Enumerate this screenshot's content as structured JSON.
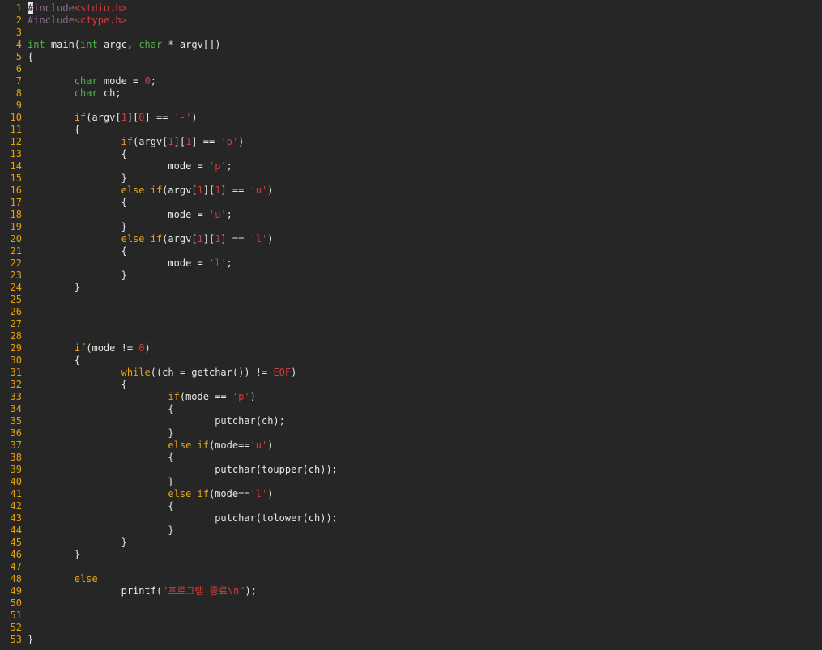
{
  "colors": {
    "background": "#262626",
    "line_number": "#e5a00a",
    "default_text": "#e6e6e6",
    "keyword": "#e8a317",
    "type": "#4fb24a",
    "string_literal": "#d43d3d",
    "preprocessor": "#8c6d8c"
  },
  "editor": {
    "lines": [
      {
        "n": "1",
        "tokens": [
          {
            "t": "#",
            "c": "cursor"
          },
          {
            "t": "include",
            "c": "preproc"
          },
          {
            "t": "<stdio.h>",
            "c": "include"
          }
        ]
      },
      {
        "n": "2",
        "tokens": [
          {
            "t": "#include",
            "c": "preproc"
          },
          {
            "t": "<ctype.h>",
            "c": "include"
          }
        ]
      },
      {
        "n": "3",
        "tokens": []
      },
      {
        "n": "4",
        "tokens": [
          {
            "t": "int",
            "c": "type"
          },
          {
            "t": " main(",
            "c": "default"
          },
          {
            "t": "int",
            "c": "type"
          },
          {
            "t": " argc, ",
            "c": "default"
          },
          {
            "t": "char",
            "c": "type"
          },
          {
            "t": " * argv[])",
            "c": "default"
          }
        ]
      },
      {
        "n": "5",
        "tokens": [
          {
            "t": "{",
            "c": "default"
          }
        ]
      },
      {
        "n": "6",
        "tokens": []
      },
      {
        "n": "7",
        "tokens": [
          {
            "t": "        ",
            "c": "default"
          },
          {
            "t": "char",
            "c": "type"
          },
          {
            "t": " mode = ",
            "c": "default"
          },
          {
            "t": "0",
            "c": "number"
          },
          {
            "t": ";",
            "c": "default"
          }
        ]
      },
      {
        "n": "8",
        "tokens": [
          {
            "t": "        ",
            "c": "default"
          },
          {
            "t": "char",
            "c": "type"
          },
          {
            "t": " ch;",
            "c": "default"
          }
        ]
      },
      {
        "n": "9",
        "tokens": []
      },
      {
        "n": "10",
        "tokens": [
          {
            "t": "        ",
            "c": "default"
          },
          {
            "t": "if",
            "c": "keyword"
          },
          {
            "t": "(argv[",
            "c": "default"
          },
          {
            "t": "1",
            "c": "number"
          },
          {
            "t": "][",
            "c": "default"
          },
          {
            "t": "0",
            "c": "number"
          },
          {
            "t": "] == ",
            "c": "default"
          },
          {
            "t": "'-'",
            "c": "string"
          },
          {
            "t": ")",
            "c": "default"
          }
        ]
      },
      {
        "n": "11",
        "tokens": [
          {
            "t": "        {",
            "c": "default"
          }
        ]
      },
      {
        "n": "12",
        "tokens": [
          {
            "t": "                ",
            "c": "default"
          },
          {
            "t": "if",
            "c": "keyword"
          },
          {
            "t": "(argv[",
            "c": "default"
          },
          {
            "t": "1",
            "c": "number"
          },
          {
            "t": "][",
            "c": "default"
          },
          {
            "t": "1",
            "c": "number"
          },
          {
            "t": "] == ",
            "c": "default"
          },
          {
            "t": "'p'",
            "c": "string"
          },
          {
            "t": ")",
            "c": "default"
          }
        ]
      },
      {
        "n": "13",
        "tokens": [
          {
            "t": "                {",
            "c": "default"
          }
        ]
      },
      {
        "n": "14",
        "tokens": [
          {
            "t": "                        mode = ",
            "c": "default"
          },
          {
            "t": "'p'",
            "c": "string"
          },
          {
            "t": ";",
            "c": "default"
          }
        ]
      },
      {
        "n": "15",
        "tokens": [
          {
            "t": "                }",
            "c": "default"
          }
        ]
      },
      {
        "n": "16",
        "tokens": [
          {
            "t": "                ",
            "c": "default"
          },
          {
            "t": "else if",
            "c": "keyword"
          },
          {
            "t": "(argv[",
            "c": "default"
          },
          {
            "t": "1",
            "c": "number"
          },
          {
            "t": "][",
            "c": "default"
          },
          {
            "t": "1",
            "c": "number"
          },
          {
            "t": "] == ",
            "c": "default"
          },
          {
            "t": "'u'",
            "c": "string"
          },
          {
            "t": ")",
            "c": "default"
          }
        ]
      },
      {
        "n": "17",
        "tokens": [
          {
            "t": "                {",
            "c": "default"
          }
        ]
      },
      {
        "n": "18",
        "tokens": [
          {
            "t": "                        mode = ",
            "c": "default"
          },
          {
            "t": "'u'",
            "c": "string"
          },
          {
            "t": ";",
            "c": "default"
          }
        ]
      },
      {
        "n": "19",
        "tokens": [
          {
            "t": "                }",
            "c": "default"
          }
        ]
      },
      {
        "n": "20",
        "tokens": [
          {
            "t": "                ",
            "c": "default"
          },
          {
            "t": "else if",
            "c": "keyword"
          },
          {
            "t": "(argv[",
            "c": "default"
          },
          {
            "t": "1",
            "c": "number"
          },
          {
            "t": "][",
            "c": "default"
          },
          {
            "t": "1",
            "c": "number"
          },
          {
            "t": "] == ",
            "c": "default"
          },
          {
            "t": "'l'",
            "c": "string"
          },
          {
            "t": ")",
            "c": "default"
          }
        ]
      },
      {
        "n": "21",
        "tokens": [
          {
            "t": "                {",
            "c": "default"
          }
        ]
      },
      {
        "n": "22",
        "tokens": [
          {
            "t": "                        mode = ",
            "c": "default"
          },
          {
            "t": "'l'",
            "c": "string"
          },
          {
            "t": ";",
            "c": "default"
          }
        ]
      },
      {
        "n": "23",
        "tokens": [
          {
            "t": "                }",
            "c": "default"
          }
        ]
      },
      {
        "n": "24",
        "tokens": [
          {
            "t": "        }",
            "c": "default"
          }
        ]
      },
      {
        "n": "25",
        "tokens": []
      },
      {
        "n": "26",
        "tokens": []
      },
      {
        "n": "27",
        "tokens": []
      },
      {
        "n": "28",
        "tokens": []
      },
      {
        "n": "29",
        "tokens": [
          {
            "t": "        ",
            "c": "default"
          },
          {
            "t": "if",
            "c": "keyword"
          },
          {
            "t": "(mode != ",
            "c": "default"
          },
          {
            "t": "0",
            "c": "number"
          },
          {
            "t": ")",
            "c": "default"
          }
        ]
      },
      {
        "n": "30",
        "tokens": [
          {
            "t": "        {",
            "c": "default"
          }
        ]
      },
      {
        "n": "31",
        "tokens": [
          {
            "t": "                ",
            "c": "default"
          },
          {
            "t": "while",
            "c": "keyword"
          },
          {
            "t": "((ch = getchar()) != ",
            "c": "default"
          },
          {
            "t": "EOF",
            "c": "number"
          },
          {
            "t": ")",
            "c": "default"
          }
        ]
      },
      {
        "n": "32",
        "tokens": [
          {
            "t": "                {",
            "c": "default"
          }
        ]
      },
      {
        "n": "33",
        "tokens": [
          {
            "t": "                        ",
            "c": "default"
          },
          {
            "t": "if",
            "c": "keyword"
          },
          {
            "t": "(mode == ",
            "c": "default"
          },
          {
            "t": "'p'",
            "c": "string"
          },
          {
            "t": ")",
            "c": "default"
          }
        ]
      },
      {
        "n": "34",
        "tokens": [
          {
            "t": "                        {",
            "c": "default"
          }
        ]
      },
      {
        "n": "35",
        "tokens": [
          {
            "t": "                                putchar(ch);",
            "c": "default"
          }
        ]
      },
      {
        "n": "36",
        "tokens": [
          {
            "t": "                        }",
            "c": "default"
          }
        ]
      },
      {
        "n": "37",
        "tokens": [
          {
            "t": "                        ",
            "c": "default"
          },
          {
            "t": "else if",
            "c": "keyword"
          },
          {
            "t": "(mode==",
            "c": "default"
          },
          {
            "t": "'u'",
            "c": "string"
          },
          {
            "t": ")",
            "c": "default"
          }
        ]
      },
      {
        "n": "38",
        "tokens": [
          {
            "t": "                        {",
            "c": "default"
          }
        ]
      },
      {
        "n": "39",
        "tokens": [
          {
            "t": "                                putchar(toupper(ch));",
            "c": "default"
          }
        ]
      },
      {
        "n": "40",
        "tokens": [
          {
            "t": "                        }",
            "c": "default"
          }
        ]
      },
      {
        "n": "41",
        "tokens": [
          {
            "t": "                        ",
            "c": "default"
          },
          {
            "t": "else if",
            "c": "keyword"
          },
          {
            "t": "(mode==",
            "c": "default"
          },
          {
            "t": "'l'",
            "c": "string"
          },
          {
            "t": ")",
            "c": "default"
          }
        ]
      },
      {
        "n": "42",
        "tokens": [
          {
            "t": "                        {",
            "c": "default"
          }
        ]
      },
      {
        "n": "43",
        "tokens": [
          {
            "t": "                                putchar(tolower(ch));",
            "c": "default"
          }
        ]
      },
      {
        "n": "44",
        "tokens": [
          {
            "t": "                        }",
            "c": "default"
          }
        ]
      },
      {
        "n": "45",
        "tokens": [
          {
            "t": "                }",
            "c": "default"
          }
        ]
      },
      {
        "n": "46",
        "tokens": [
          {
            "t": "        }",
            "c": "default"
          }
        ]
      },
      {
        "n": "47",
        "tokens": []
      },
      {
        "n": "48",
        "tokens": [
          {
            "t": "        ",
            "c": "default"
          },
          {
            "t": "else",
            "c": "keyword"
          }
        ]
      },
      {
        "n": "49",
        "tokens": [
          {
            "t": "                printf(",
            "c": "default"
          },
          {
            "t": "\"프로그램 종료\\n\"",
            "c": "string"
          },
          {
            "t": ");",
            "c": "default"
          }
        ]
      },
      {
        "n": "50",
        "tokens": []
      },
      {
        "n": "51",
        "tokens": []
      },
      {
        "n": "52",
        "tokens": []
      },
      {
        "n": "53",
        "tokens": [
          {
            "t": "}",
            "c": "default"
          }
        ]
      }
    ]
  }
}
